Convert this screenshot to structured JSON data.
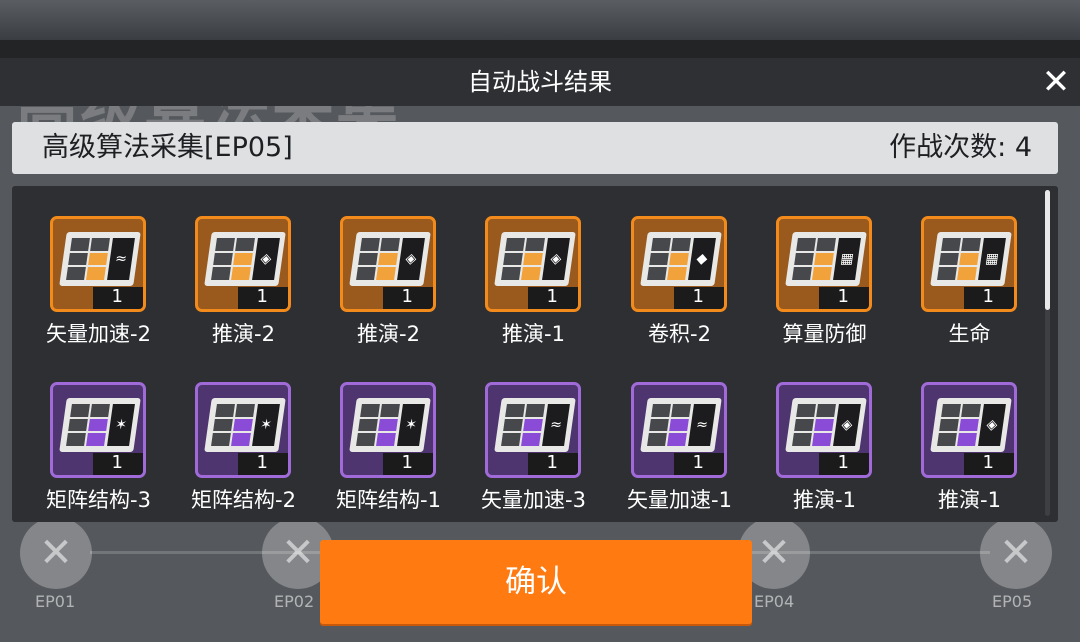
{
  "background": {
    "stage_title": "高级算法采集",
    "episodes": [
      "EP01",
      "EP02",
      "EP04",
      "EP05"
    ]
  },
  "dialog": {
    "title": "自动战斗结果",
    "close_icon": "close-icon",
    "stage_name": "高级算法采集[EP05]",
    "battle_count": "作战次数: 4",
    "confirm_label": "确认"
  },
  "colors": {
    "orange_rarity": "#f28a1c",
    "purple_rarity": "#a06bd8",
    "confirm_button": "#ff7a10"
  },
  "items": [
    {
      "name": "矢量加速-2",
      "qty": "1",
      "rarity": "orange",
      "symbol": "≈"
    },
    {
      "name": "推演-2",
      "qty": "1",
      "rarity": "orange",
      "symbol": "◈"
    },
    {
      "name": "推演-2",
      "qty": "1",
      "rarity": "orange",
      "symbol": "◈"
    },
    {
      "name": "推演-1",
      "qty": "1",
      "rarity": "orange",
      "symbol": "◈"
    },
    {
      "name": "卷积-2",
      "qty": "1",
      "rarity": "orange",
      "symbol": "◆"
    },
    {
      "name": "算量防御",
      "qty": "1",
      "rarity": "orange",
      "symbol": "▦"
    },
    {
      "name": "生命",
      "qty": "1",
      "rarity": "orange",
      "symbol": "▦"
    },
    {
      "name": "矩阵结构-3",
      "qty": "1",
      "rarity": "purple",
      "symbol": "✶"
    },
    {
      "name": "矩阵结构-2",
      "qty": "1",
      "rarity": "purple",
      "symbol": "✶"
    },
    {
      "name": "矩阵结构-1",
      "qty": "1",
      "rarity": "purple",
      "symbol": "✶"
    },
    {
      "name": "矢量加速-3",
      "qty": "1",
      "rarity": "purple",
      "symbol": "≈"
    },
    {
      "name": "矢量加速-1",
      "qty": "1",
      "rarity": "purple",
      "symbol": "≈"
    },
    {
      "name": "推演-1",
      "qty": "1",
      "rarity": "purple",
      "symbol": "◈"
    },
    {
      "name": "推演-1",
      "qty": "1",
      "rarity": "purple",
      "symbol": "◈"
    }
  ]
}
